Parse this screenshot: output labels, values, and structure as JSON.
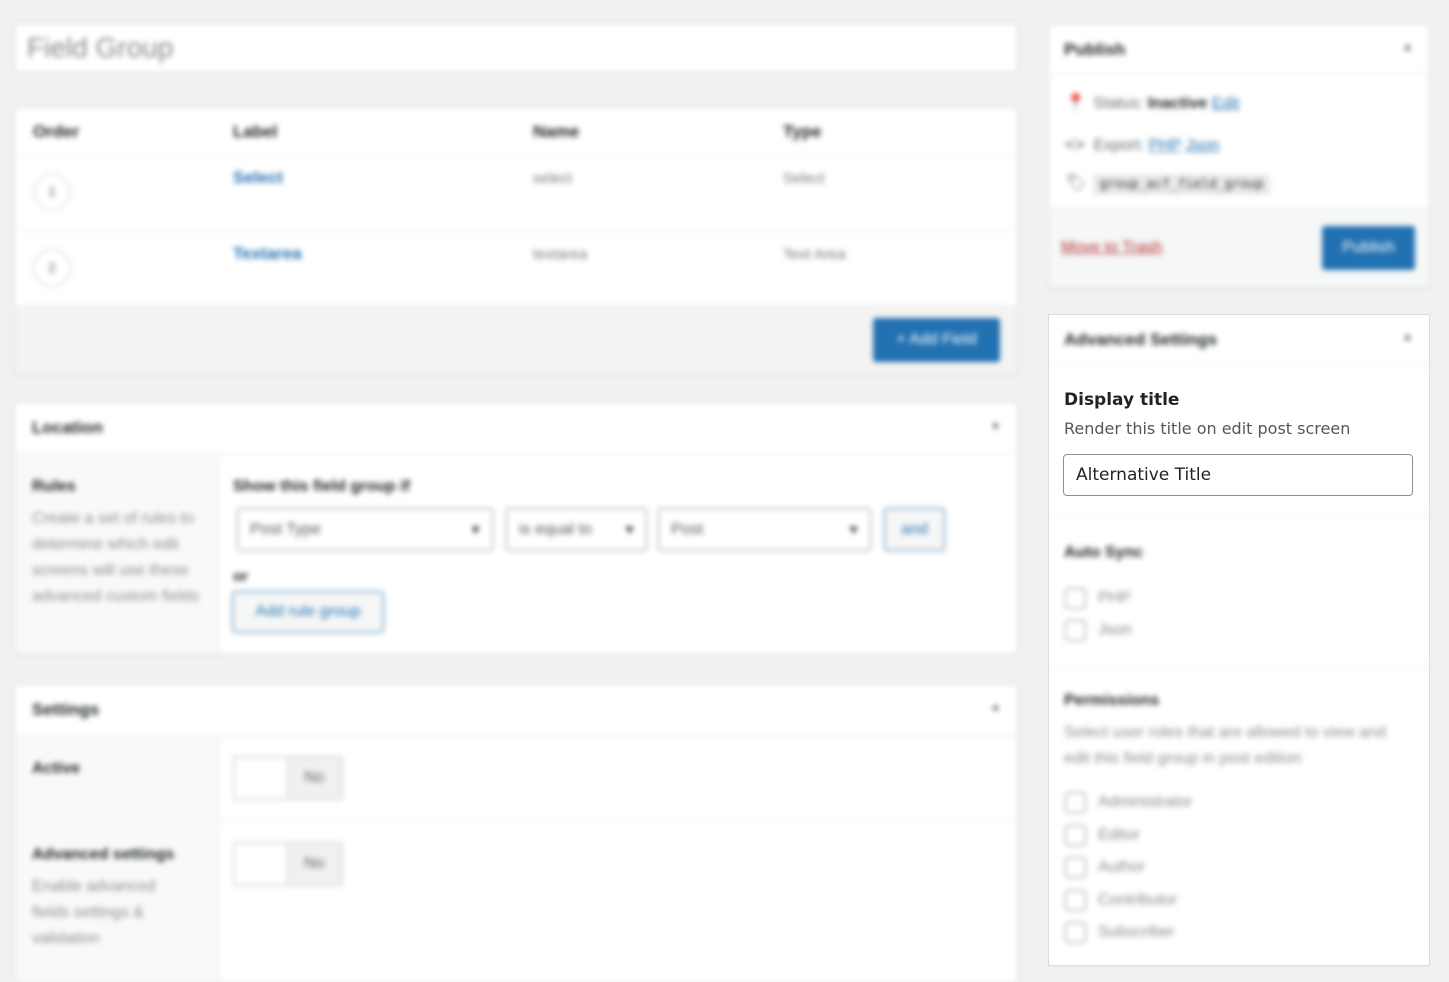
{
  "title_field": {
    "placeholder": "Field Group"
  },
  "fields_table": {
    "columns": [
      "Order",
      "Label",
      "Name",
      "Type"
    ],
    "rows": [
      {
        "order": "1",
        "label": "Select",
        "name": "select",
        "type": "Select"
      },
      {
        "order": "2",
        "label": "Textarea",
        "name": "textarea",
        "type": "Text Area"
      }
    ],
    "add_button": "+ Add Field"
  },
  "location": {
    "title": "Location",
    "rules_label": "Rules",
    "rules_desc": "Create a set of rules to determine which edit screens will use these advanced custom fields",
    "show_if": "Show this field group if",
    "param_select": "Post Type",
    "operator_select": "is equal to",
    "value_select": "Post",
    "and_button": "and",
    "or_text": "or",
    "add_rule_group": "Add rule group"
  },
  "settings": {
    "title": "Settings",
    "active_label": "Active",
    "active_value": "No",
    "advanced_label": "Advanced settings",
    "advanced_desc": "Enable advanced fields settings & validation",
    "advanced_value": "No"
  },
  "publish": {
    "title": "Publish",
    "status_label": "Status:",
    "status_value": "Inactive",
    "status_edit": "Edit",
    "export_label": "Export:",
    "export_php": "PHP",
    "export_json": "Json",
    "key": "group_acf_field_group",
    "trash": "Move to Trash",
    "button": "Publish"
  },
  "advanced_settings": {
    "title": "Advanced Settings",
    "display_title_label": "Display title",
    "display_title_desc": "Render this title on edit post screen",
    "display_title_value": "Alternative Title",
    "auto_sync_title": "Auto Sync",
    "auto_sync_options": [
      "PHP",
      "Json"
    ],
    "permissions_title": "Permissions",
    "permissions_desc": "Select user roles that are allowed to view and edit this field group in post edition",
    "roles": [
      "Administrator",
      "Editor",
      "Author",
      "Contributor",
      "Subscriber"
    ]
  },
  "colors": {
    "accent": "#2271b1",
    "danger": "#b32d2e",
    "background": "#f1f1f1"
  }
}
